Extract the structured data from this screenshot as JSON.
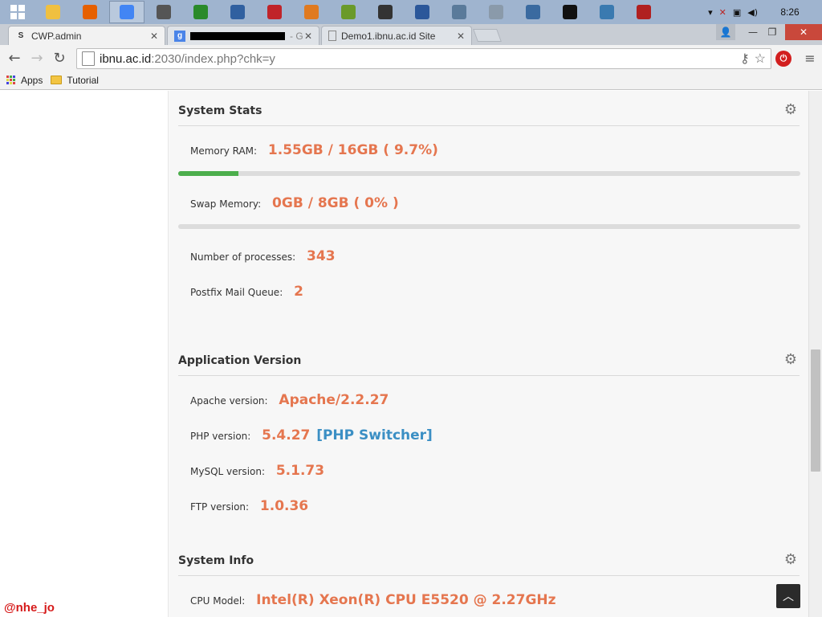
{
  "taskbar": {
    "clock": "8:26",
    "apps": [
      {
        "icon": "file-explorer-icon",
        "color": "#f0c040"
      },
      {
        "icon": "firefox-icon",
        "color": "#e66000"
      },
      {
        "icon": "chrome-icon",
        "color": "#4285f4",
        "active": true
      },
      {
        "icon": "putty-icon",
        "color": "#555555"
      },
      {
        "icon": "network-tool-icon",
        "color": "#2a8a2a"
      },
      {
        "icon": "virtualbox-icon",
        "color": "#3060a0"
      },
      {
        "icon": "filezilla-icon",
        "color": "#c0242a"
      },
      {
        "icon": "window-icon",
        "color": "#e07a20"
      },
      {
        "icon": "sync-icon",
        "color": "#6a9a2a"
      },
      {
        "icon": "media-icon",
        "color": "#333333"
      },
      {
        "icon": "word-icon",
        "color": "#2b579a"
      },
      {
        "icon": "tool-icon",
        "color": "#5a7a9a"
      },
      {
        "icon": "grid-icon",
        "color": "#8a9aaa"
      },
      {
        "icon": "remote-desktop-icon",
        "color": "#3a6aa0"
      },
      {
        "icon": "cmd-icon",
        "color": "#111111"
      },
      {
        "icon": "monitor-icon",
        "color": "#3a7ab0"
      },
      {
        "icon": "record-icon",
        "color": "#b02020"
      }
    ]
  },
  "browser": {
    "tabs": [
      {
        "title": "CWP.admin",
        "favicon": "S",
        "active": true
      },
      {
        "title": "- G",
        "favicon": "g",
        "redacted": true
      },
      {
        "title": "Demo1.ibnu.ac.id Site",
        "favicon": ""
      }
    ],
    "url_host": "ibnu.ac.id",
    "url_path": ":2030/index.php?chk=y",
    "bookmarks": [
      {
        "label": "Apps"
      },
      {
        "label": "Tutorial"
      }
    ]
  },
  "system_stats": {
    "title": "System Stats",
    "memory_label": "Memory RAM:",
    "memory_value": "1.55GB / 16GB ( 9.7%)",
    "memory_fraction": 0.097,
    "swap_label": "Swap Memory:",
    "swap_value": "0GB / 8GB ( 0% )",
    "swap_fraction": 0,
    "processes_label": "Number of processes:",
    "processes_value": "343",
    "mailqueue_label": "Postfix Mail Queue:",
    "mailqueue_value": "2"
  },
  "app_version": {
    "title": "Application Version",
    "apache_label": "Apache version:",
    "apache_value": "Apache/2.2.27",
    "php_label": "PHP version:",
    "php_value": "5.4.27",
    "php_switcher": "[PHP Switcher]",
    "mysql_label": "MySQL version:",
    "mysql_value": "5.1.73",
    "ftp_label": "FTP version:",
    "ftp_value": "1.0.36"
  },
  "system_info": {
    "title": "System Info",
    "cpu_label": "CPU Model:",
    "cpu_value": "Intel(R) Xeon(R) CPU E5520 @ 2.27GHz"
  },
  "watermark": "@nhe_jo"
}
